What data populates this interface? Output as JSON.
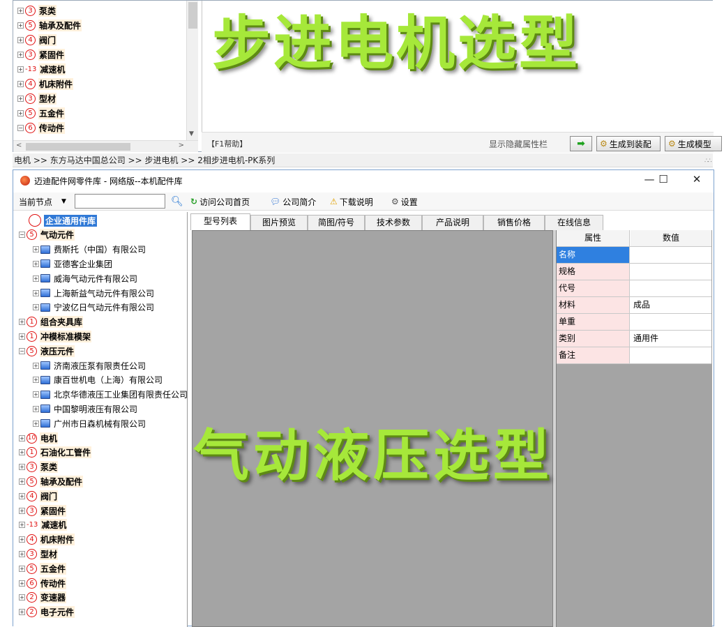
{
  "top_window": {
    "tree_items": [
      {
        "num": "3",
        "label": "泵类"
      },
      {
        "num": "5",
        "label": "轴承及配件"
      },
      {
        "num": "4",
        "label": "阀门"
      },
      {
        "num": "3",
        "label": "紧固件"
      },
      {
        "num": "13",
        "label": "减速机",
        "plain": true
      },
      {
        "num": "4",
        "label": "机床附件"
      },
      {
        "num": "3",
        "label": "型材"
      },
      {
        "num": "5",
        "label": "五金件"
      },
      {
        "num": "6",
        "label": "传动件"
      }
    ],
    "watermark": "步进电机选型",
    "help_text": "【F1帮助】",
    "toggle_attr_label": "显示隐藏属性栏",
    "gen_assembly_label": "生成到装配",
    "gen_model_label": "生成模型"
  },
  "breadcrumb": "电机 >> 东方马达中国总公司 >> 步进电机 >> 2相步进电机-PK系列",
  "main_window": {
    "title": "迈迪配件网零件库 - 网络版--本机配件库",
    "toolbar": {
      "node_label": "当前节点",
      "node_input_value": "",
      "visit_home": "访问公司首页",
      "company_intro": "公司简介",
      "download_info": "下载说明",
      "settings": "设置"
    },
    "tree": {
      "root": "企业通用件库",
      "items": [
        {
          "num": "5",
          "label": "气动元件",
          "expanded": true,
          "children": [
            "费斯托（中国）有限公司",
            "亚德客企业集团",
            "威海气动元件有限公司",
            "上海新益气动元件有限公司",
            "宁波亿日气动元件有限公司"
          ]
        },
        {
          "num": "1",
          "label": "组合夹具库"
        },
        {
          "num": "1",
          "label": "冲模标准模架"
        },
        {
          "num": "5",
          "label": "液压元件",
          "expanded": true,
          "children": [
            "济南液压泵有限责任公司",
            "康百世机电（上海）有限公司",
            "北京华德液压工业集团有限责任公司",
            "中国黎明液压有限公司",
            "广州市日森机械有限公司"
          ]
        },
        {
          "num": "10",
          "label": "电机"
        },
        {
          "num": "1",
          "label": "石油化工管件"
        },
        {
          "num": "3",
          "label": "泵类"
        },
        {
          "num": "5",
          "label": "轴承及配件"
        },
        {
          "num": "4",
          "label": "阀门"
        },
        {
          "num": "3",
          "label": "紧固件"
        },
        {
          "num": "13",
          "label": "减速机",
          "plain": true
        },
        {
          "num": "4",
          "label": "机床附件"
        },
        {
          "num": "3",
          "label": "型材"
        },
        {
          "num": "5",
          "label": "五金件"
        },
        {
          "num": "6",
          "label": "传动件"
        },
        {
          "num": "2",
          "label": "变速器"
        },
        {
          "num": "2",
          "label": "电子元件"
        }
      ]
    },
    "tabs": [
      "型号列表",
      "图片预览",
      "简图/符号",
      "技术参数",
      "产品说明",
      "销售价格",
      "在线信息"
    ],
    "active_tab": 0,
    "properties": {
      "header_key": "属性",
      "header_value": "数值",
      "rows": [
        {
          "key": "名称",
          "value": ""
        },
        {
          "key": "规格",
          "value": ""
        },
        {
          "key": "代号",
          "value": ""
        },
        {
          "key": "材料",
          "value": "成品"
        },
        {
          "key": "单重",
          "value": ""
        },
        {
          "key": "类别",
          "value": "通用件"
        },
        {
          "key": "备注",
          "value": ""
        }
      ]
    },
    "watermark": "气动液压选型"
  }
}
